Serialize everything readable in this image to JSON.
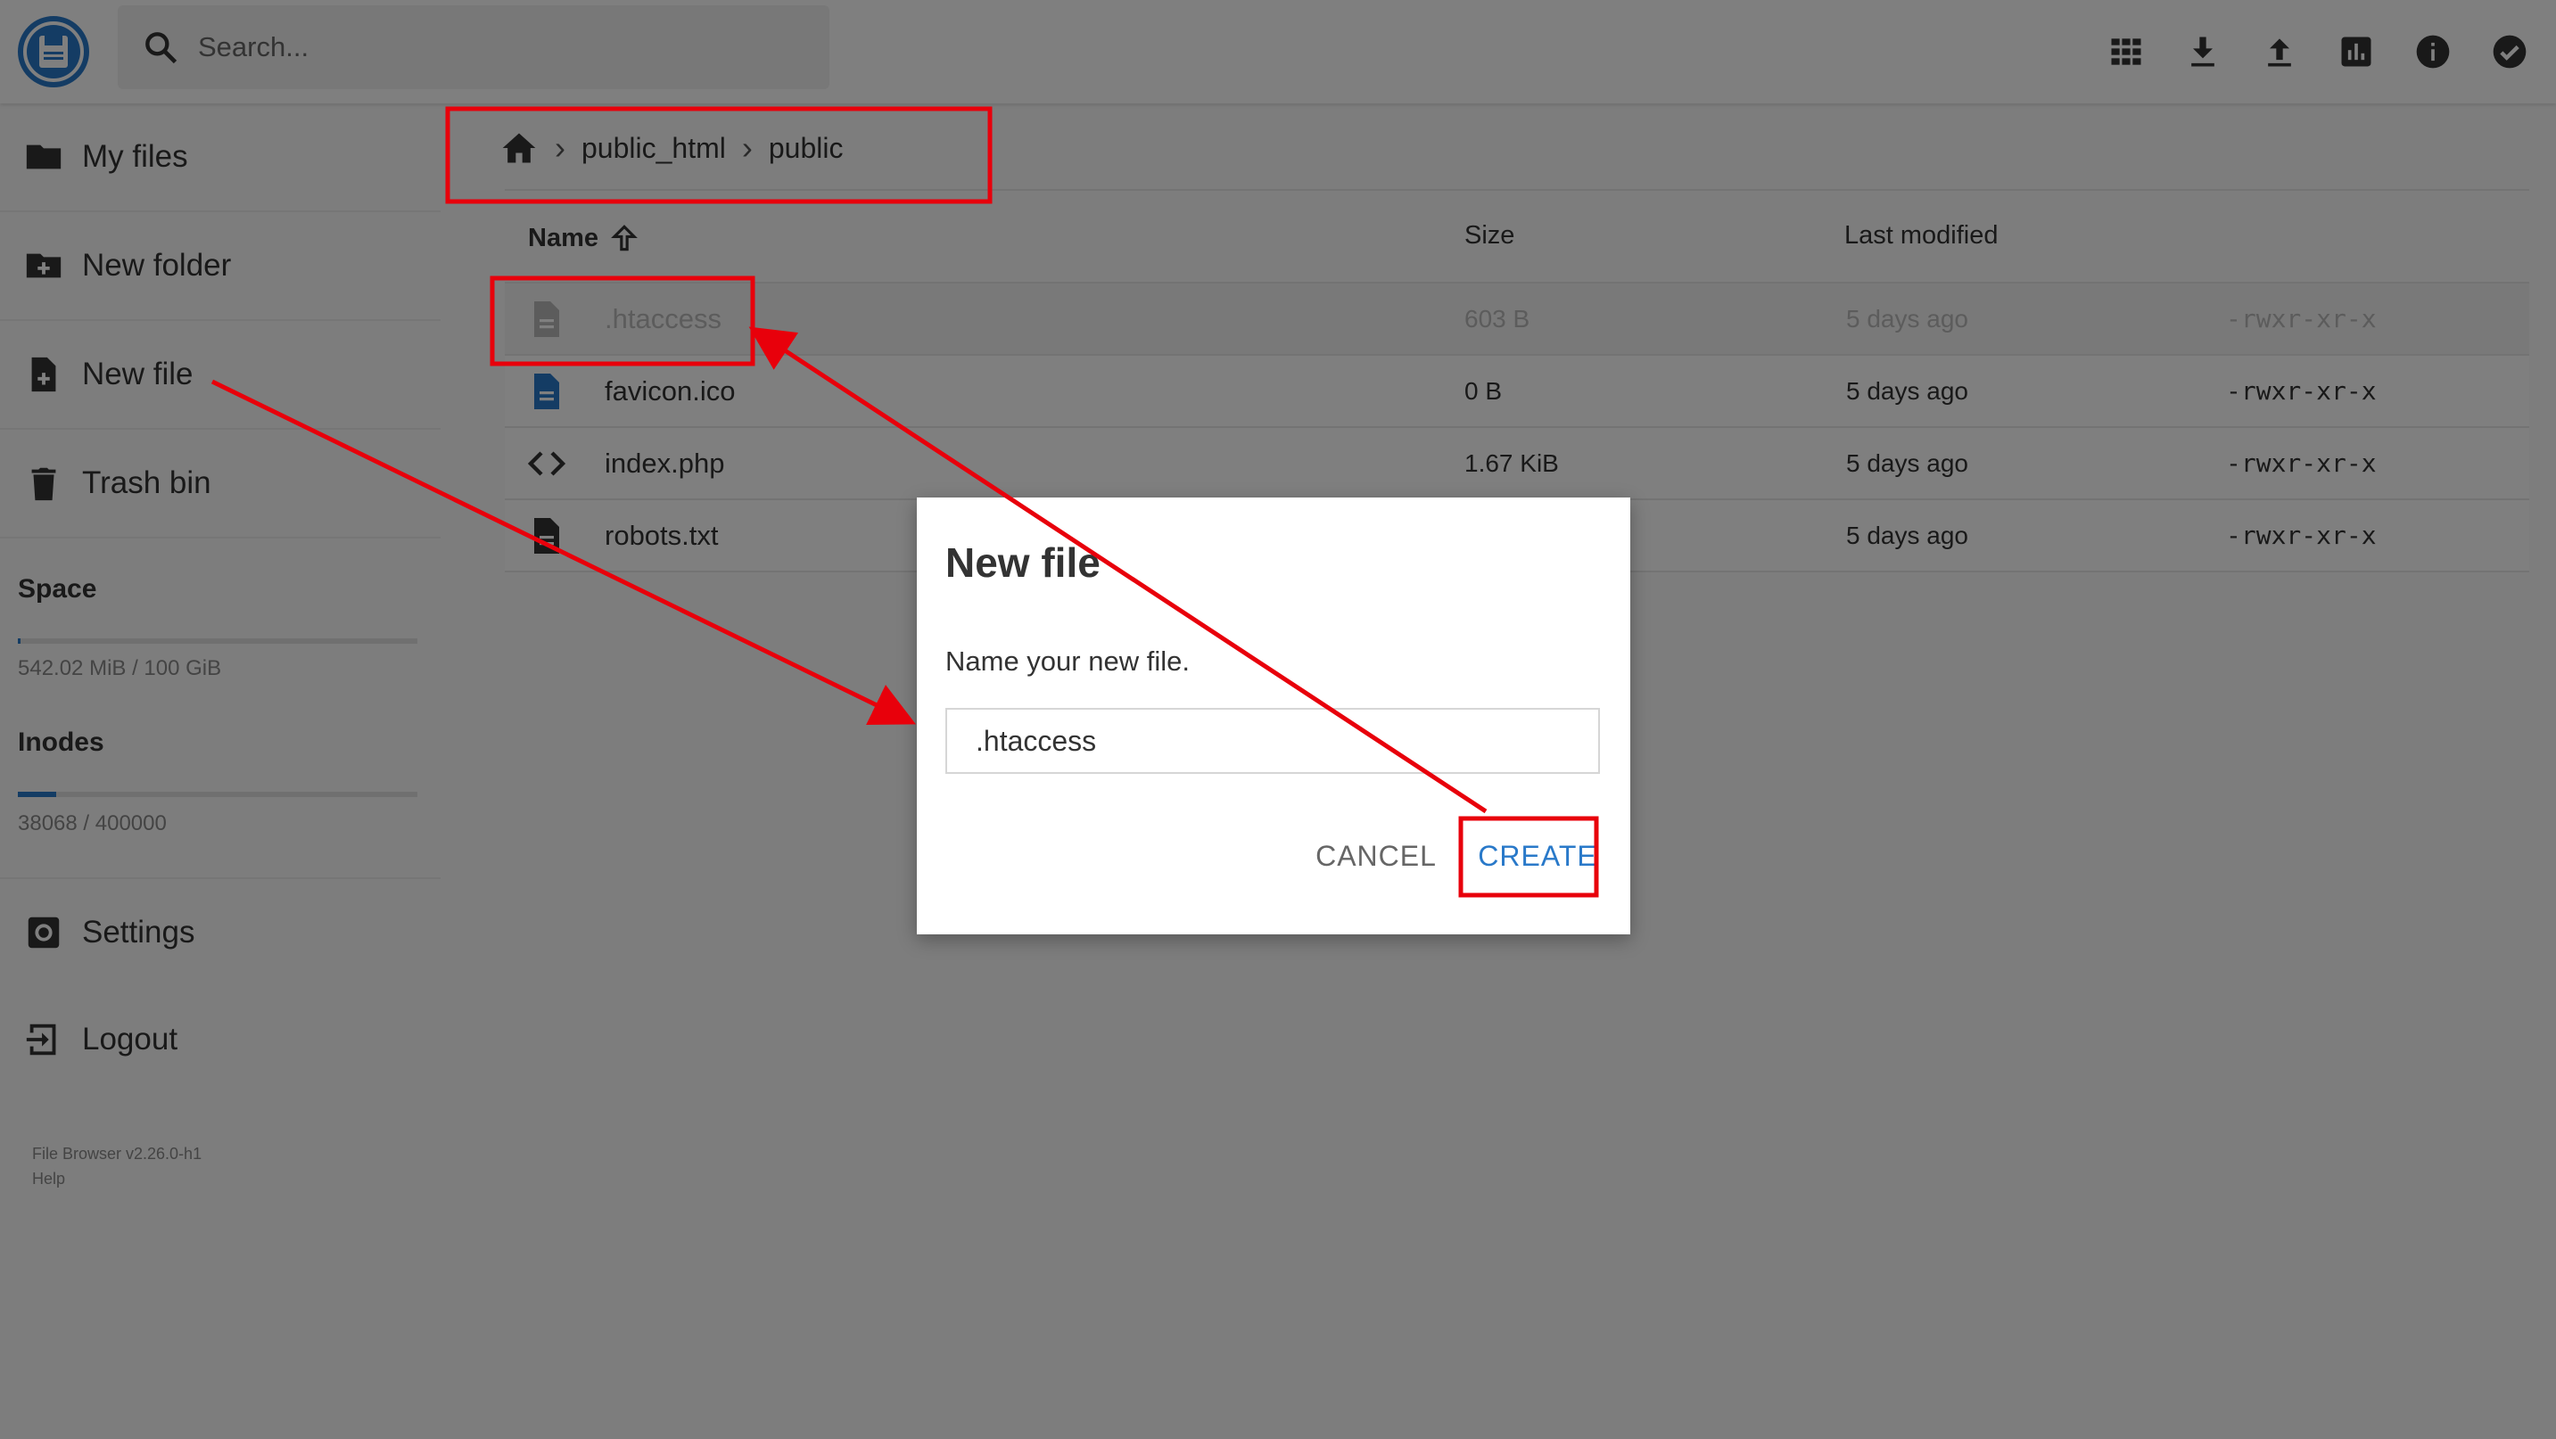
{
  "header": {
    "search_placeholder": "Search...",
    "icons": [
      "view-grid-icon",
      "download-icon",
      "upload-icon",
      "stats-icon",
      "info-icon",
      "check-circle-icon"
    ]
  },
  "sidebar": {
    "items": [
      {
        "label": "My files",
        "icon": "folder-icon"
      },
      {
        "label": "New folder",
        "icon": "new-folder-icon"
      },
      {
        "label": "New file",
        "icon": "new-file-icon"
      },
      {
        "label": "Trash bin",
        "icon": "trash-icon"
      }
    ],
    "space": {
      "title": "Space",
      "usage": "542.02 MiB / 100 GiB",
      "fraction": 0.005
    },
    "inodes": {
      "title": "Inodes",
      "usage": "38068 / 400000",
      "fraction": 0.095
    },
    "settings": {
      "label": "Settings",
      "icon": "settings-icon"
    },
    "logout": {
      "label": "Logout",
      "icon": "logout-icon"
    },
    "version": "File Browser v2.26.0-h1",
    "help": "Help"
  },
  "breadcrumb": {
    "items": [
      "public_html",
      "public"
    ]
  },
  "table": {
    "headers": {
      "name": "Name",
      "size": "Size",
      "modified": "Last modified"
    },
    "rows": [
      {
        "name": ".htaccess",
        "size": "603 B",
        "modified": "5 days ago",
        "perms": "-rwxr-xr-x",
        "icon": "file-icon",
        "selected": true
      },
      {
        "name": "favicon.ico",
        "size": "0 B",
        "modified": "5 days ago",
        "perms": "-rwxr-xr-x",
        "icon": "image-file-icon",
        "selected": false
      },
      {
        "name": "index.php",
        "size": "1.67 KiB",
        "modified": "5 days ago",
        "perms": "-rwxr-xr-x",
        "icon": "code-icon",
        "selected": false
      },
      {
        "name": "robots.txt",
        "size": "",
        "modified": "5 days ago",
        "perms": "-rwxr-xr-x",
        "icon": "file-icon",
        "selected": false
      }
    ]
  },
  "dialog": {
    "title": "New file",
    "message": "Name your new file.",
    "input_value": ".htaccess",
    "cancel_label": "CANCEL",
    "create_label": "CREATE"
  },
  "colors": {
    "accent": "#2979c9",
    "annotation": "#e8000b"
  }
}
